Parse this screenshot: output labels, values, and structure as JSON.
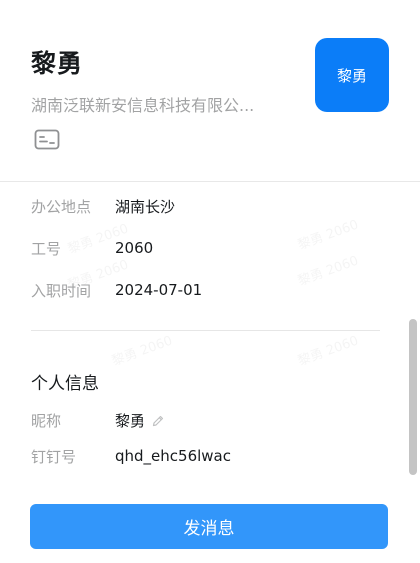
{
  "profile": {
    "name": "黎勇",
    "company": "湖南泛联新安信息科技有限公...",
    "avatar_text": "黎勇"
  },
  "work_info": {
    "rows": [
      {
        "label": "办公地点",
        "value": "湖南长沙"
      },
      {
        "label": "工号",
        "value": "2060"
      },
      {
        "label": "入职时间",
        "value": "2024-07-01"
      }
    ]
  },
  "personal_info": {
    "title": "个人信息",
    "nickname_label": "昵称",
    "nickname_value": "黎勇",
    "dingtalk_label": "钉钉号",
    "dingtalk_value": "qhd_ehc56lwac"
  },
  "actions": {
    "send_message_label": "发消息"
  },
  "colors": {
    "avatar_bg": "#0b7df8",
    "button_bg": "#3296fa",
    "label_gray": "#a2a3a4"
  },
  "icons": {
    "business_card": "business-card-icon",
    "edit": "pencil-icon"
  }
}
